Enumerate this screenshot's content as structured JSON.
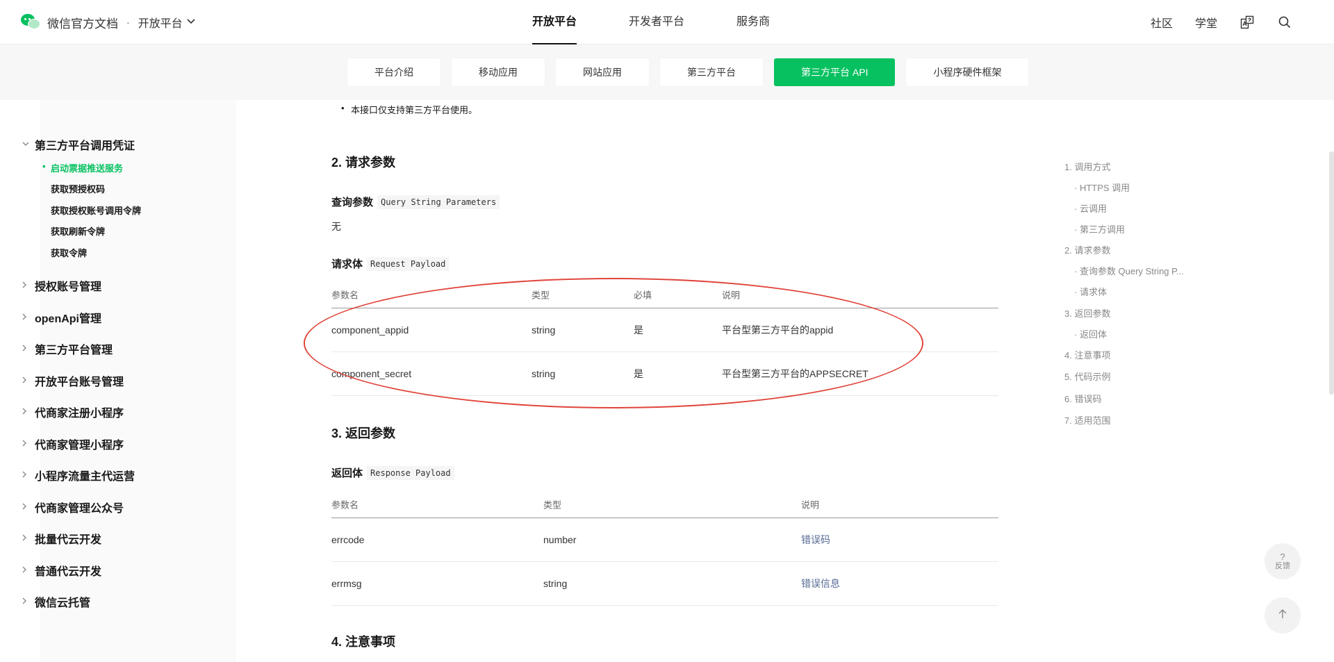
{
  "header": {
    "brand_title": "微信官方文档",
    "brand_dot": "·",
    "brand_platform": "开放平台",
    "topnav": [
      {
        "label": "开放平台",
        "active": true
      },
      {
        "label": "开发者平台",
        "active": false
      },
      {
        "label": "服务商",
        "active": false
      }
    ],
    "right_links": [
      "社区",
      "学堂"
    ]
  },
  "subnav": {
    "tabs": [
      {
        "label": "平台介绍",
        "active": false
      },
      {
        "label": "移动应用",
        "active": false
      },
      {
        "label": "网站应用",
        "active": false
      },
      {
        "label": "第三方平台",
        "active": false
      },
      {
        "label": "第三方平台 API",
        "active": true
      },
      {
        "label": "小程序硬件框架",
        "active": false
      }
    ]
  },
  "sidebar": {
    "expanded_group": {
      "label": "第三方平台调用凭证",
      "children": [
        {
          "label": "启动票据推送服务",
          "active": true
        },
        {
          "label": "获取预授权码",
          "active": false
        },
        {
          "label": "获取授权账号调用令牌",
          "active": false
        },
        {
          "label": "获取刷新令牌",
          "active": false
        },
        {
          "label": "获取令牌",
          "active": false
        }
      ]
    },
    "groups": [
      "授权账号管理",
      "openApi管理",
      "第三方平台管理",
      "开放平台账号管理",
      "代商家注册小程序",
      "代商家管理小程序",
      "小程序流量主代运营",
      "代商家管理公众号",
      "批量代云开发",
      "普通代云开发",
      "微信云托管"
    ]
  },
  "content": {
    "note": "本接口仅支持第三方平台使用。",
    "section2_title": "2. 请求参数",
    "query_title": "查询参数",
    "query_code": "Query String Parameters",
    "query_none": "无",
    "body_title": "请求体",
    "body_code": "Request Payload",
    "request_table": {
      "headers": [
        "参数名",
        "类型",
        "必填",
        "说明"
      ],
      "rows": [
        [
          "component_appid",
          "string",
          "是",
          "平台型第三方平台的appid"
        ],
        [
          "component_secret",
          "string",
          "是",
          "平台型第三方平台的APPSECRET"
        ]
      ]
    },
    "section3_title": "3. 返回参数",
    "resp_title": "返回体",
    "resp_code": "Response Payload",
    "response_table": {
      "headers": [
        "参数名",
        "类型",
        "说明"
      ],
      "rows": [
        [
          "errcode",
          "number",
          "错误码"
        ],
        [
          "errmsg",
          "string",
          "错误信息"
        ]
      ]
    },
    "section4_title": "4. 注意事项"
  },
  "toc": [
    {
      "label": "1. 调用方式",
      "sub": false
    },
    {
      "label": "· HTTPS 调用",
      "sub": true
    },
    {
      "label": "· 云调用",
      "sub": true
    },
    {
      "label": "· 第三方调用",
      "sub": true
    },
    {
      "label": "2. 请求参数",
      "sub": false
    },
    {
      "label": "· 查询参数 Query String P...",
      "sub": true
    },
    {
      "label": "· 请求体",
      "sub": true
    },
    {
      "label": "3. 返回参数",
      "sub": false
    },
    {
      "label": "· 返回体",
      "sub": true
    },
    {
      "label": "4. 注意事项",
      "sub": false
    },
    {
      "label": "5. 代码示例",
      "sub": false
    },
    {
      "label": "6. 错误码",
      "sub": false
    },
    {
      "label": "7. 适用范围",
      "sub": false
    }
  ],
  "floating": {
    "feedback_symbol": "?",
    "feedback_label": "反馈",
    "back_to_top_icon": "arrow-up-icon"
  },
  "colors": {
    "brand_green": "#07c160",
    "link_blue": "#576b95",
    "annotation_red": "#e0443a"
  }
}
